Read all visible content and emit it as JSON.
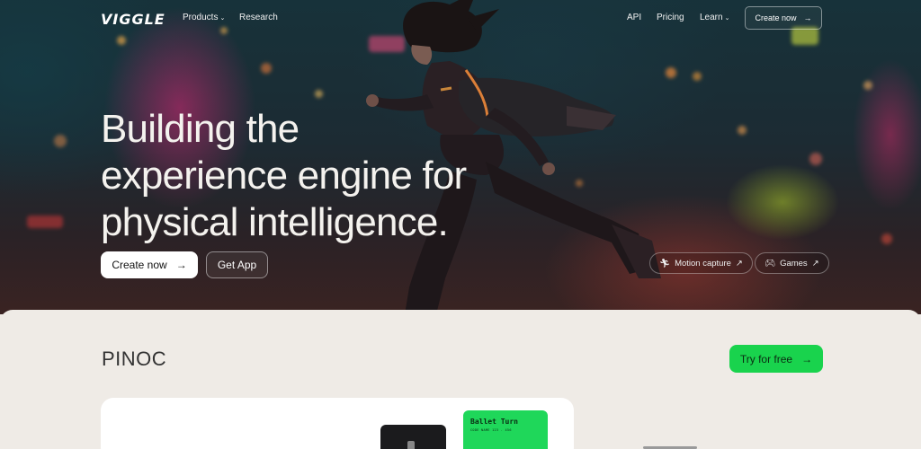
{
  "nav": {
    "logo": "VIGGLE",
    "products": "Products",
    "research": "Research",
    "api": "API",
    "pricing": "Pricing",
    "learn": "Learn",
    "create_now": "Create now"
  },
  "hero": {
    "headline_line1": "Building the",
    "headline_line2": "experience engine for",
    "headline_line3": "physical intelligence.",
    "create_now": "Create now",
    "get_app": "Get App",
    "chips": [
      {
        "label": "Motion capture",
        "icon": "running-person-icon"
      },
      {
        "label": "Games",
        "icon": "gamepad-icon"
      }
    ]
  },
  "section": {
    "title": "PINOC",
    "try_free": "Try for free",
    "card": {
      "green_title": "Ballet Turn",
      "green_sub": "CODE NAME 123 . 456"
    }
  },
  "colors": {
    "accent_green": "#19d34d",
    "page_bg": "#efebe6"
  }
}
